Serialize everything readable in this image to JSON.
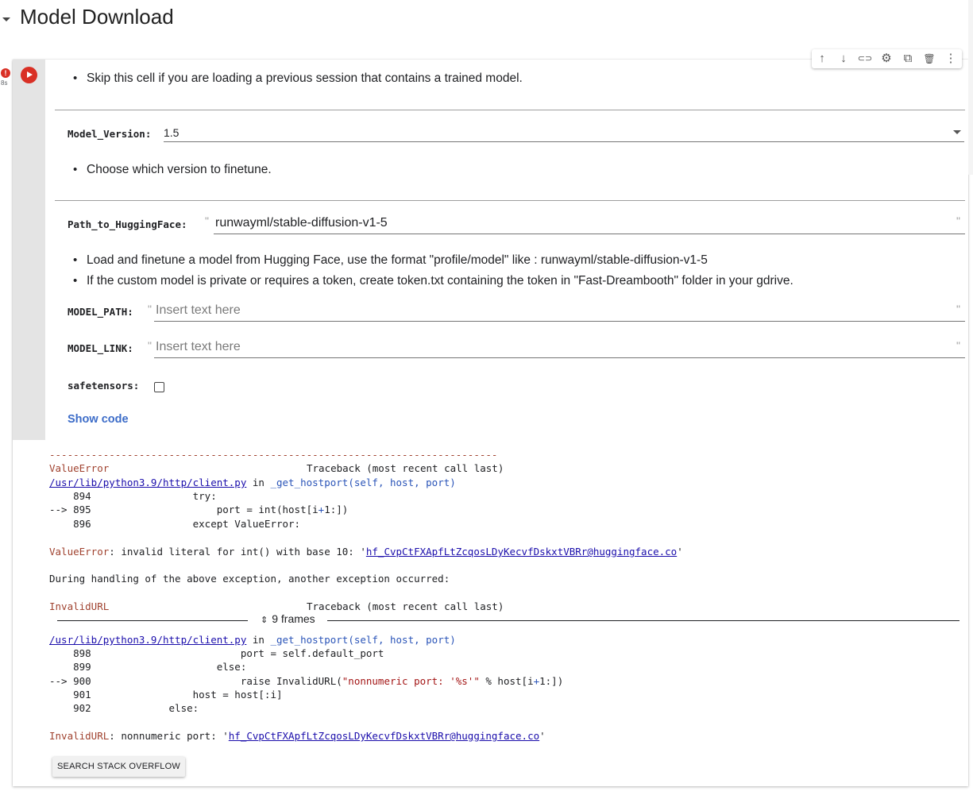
{
  "section": {
    "title": "Model Download",
    "collapse_icon": "caret-down-icon"
  },
  "cell": {
    "error_badge": "!",
    "exec_time": "8s",
    "run_icon": "play-icon",
    "toolbar": [
      "arrow-up-icon",
      "arrow-down-icon",
      "link-icon",
      "gear-icon",
      "mirror-cell-icon",
      "trash-icon",
      "more-vert-icon"
    ],
    "toolbar_glyphs": [
      "↑",
      "↓",
      "⊂⊃",
      "⚙",
      "⧉",
      "🗑",
      "⋮"
    ],
    "notes": {
      "skip": "Skip this cell if you are loading a previous session that contains a trained model.",
      "choose": "Choose which version to finetune.",
      "hf_load": "Load and finetune a model from Hugging Face, use the format \"profile/model\" like : runwayml/stable-diffusion-v1-5",
      "hf_private": "If the custom model is private or requires a token, create token.txt containing the token in \"Fast-Dreambooth\" folder in your gdrive."
    },
    "fields": {
      "model_version": {
        "label": "Model_Version:",
        "value": "1.5"
      },
      "path_to_hf": {
        "label": "Path_to_HuggingFace:",
        "value": "runwayml/stable-diffusion-v1-5"
      },
      "model_path": {
        "label": "MODEL_PATH:",
        "placeholder": "Insert text here"
      },
      "model_link": {
        "label": "MODEL_LINK:",
        "placeholder": "Insert text here"
      },
      "safetensors": {
        "label": "safetensors:",
        "checked": false
      }
    },
    "show_code": "Show code"
  },
  "output": {
    "dash": "---------------------------------------------------------------------------",
    "err1_name": "ValueError",
    "tb_head": "Traceback (most recent call last)",
    "file1": "/usr/lib/python3.9/http/client.py",
    "in_word": " in ",
    "func1": "_get_hostport",
    "args1": "(self, host, port)",
    "l894": "    894                 try:",
    "l895a": "--> 895                     port = int(host[i",
    "l895b": "+",
    "l895c": "1:])",
    "l896": "    896                 except ValueError:",
    "err1_msg": ": invalid literal for int() with base 10: '",
    "err1_link": "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@huggingface.co",
    "err1_end": "'",
    "during": "During handling of the above exception, another exception occurred:",
    "err2_name": "InvalidURL",
    "frames": "9 frames",
    "l898": "    898                         port = self.default_port",
    "l899": "    899                     else:",
    "l900a": "--> 900                         raise InvalidURL(",
    "l900b": "\"nonnumeric port: '%s'\"",
    "l900c": " % host[i",
    "l900d": "+",
    "l900e": "1:])",
    "l901": "    901                 host = host[:i]",
    "l902": "    902             else:",
    "err2_msg": ": nonnumeric port: '",
    "err2_link": "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@huggingface.co",
    "err2_end": "'",
    "so_button": "SEARCH STACK OVERFLOW"
  }
}
